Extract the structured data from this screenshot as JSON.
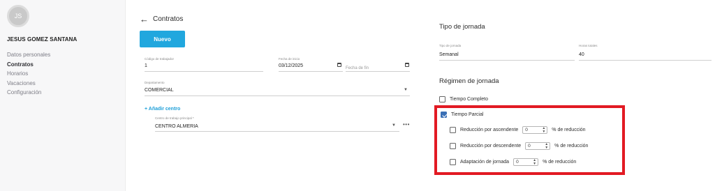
{
  "sidebar": {
    "avatar_initials": "JS",
    "user_name": "JESUS GOMEZ SANTANA",
    "items": [
      {
        "label": "Datos personales",
        "active": false
      },
      {
        "label": "Contratos",
        "active": true
      },
      {
        "label": "Horarios",
        "active": false
      },
      {
        "label": "Vacaciones",
        "active": false
      },
      {
        "label": "Configuración",
        "active": false
      }
    ]
  },
  "header": {
    "back_icon": "arrow-left-icon",
    "title": "Contratos"
  },
  "actions": {
    "new_label": "Nuevo"
  },
  "form": {
    "worker_code": {
      "label": "Código de trabajador",
      "value": "1"
    },
    "start_date": {
      "label": "Fecha de inicio",
      "value": "03/12/2025"
    },
    "end_date": {
      "placeholder": "Fecha de fin"
    },
    "department": {
      "label": "Departamento",
      "value": "COMERCIAL"
    },
    "add_center_label": "+ Añadir centro",
    "main_center": {
      "label": "Centro de trabajo principal *",
      "value": "CENTRO ALMERIA"
    },
    "more_label": "•••"
  },
  "jornada": {
    "title": "Tipo de jornada",
    "type": {
      "label": "Tipo de jornada",
      "value": "Semanal"
    },
    "hours": {
      "label": "Horas totales",
      "value": "40"
    }
  },
  "regimen": {
    "title": "Régimen de jornada",
    "full_time": {
      "label": "Tiempo Completo",
      "checked": false
    },
    "part_time": {
      "label": "Tiempo Parcial",
      "checked": true
    },
    "options": [
      {
        "label": "Reducción por ascendente",
        "value": "0",
        "suffix": "% de reducción",
        "checked": false
      },
      {
        "label": "Reducción por descendente",
        "value": "0",
        "suffix": "% de reducción",
        "checked": false
      },
      {
        "label": "Adaptación de jornada",
        "value": "0",
        "suffix": "% de reducción",
        "checked": false
      }
    ],
    "highlight_color": "#e21a23"
  },
  "colors": {
    "accent": "#21a7de",
    "checkbox": "#3a6fb5"
  }
}
